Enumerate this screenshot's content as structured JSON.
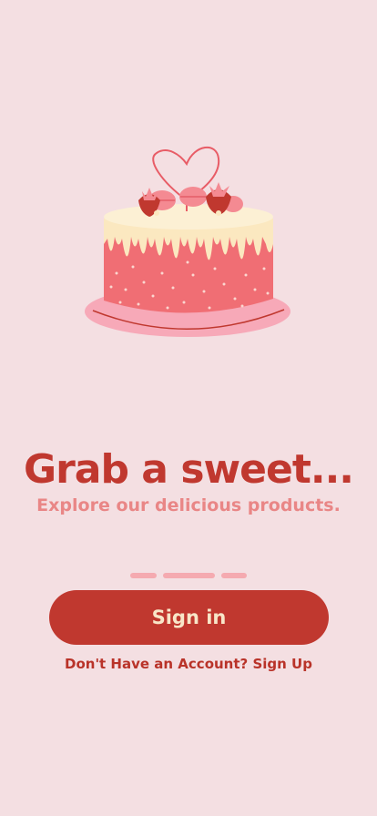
{
  "onboarding": {
    "headline": "Grab a sweet...",
    "subheadline": "Explore our delicious products.",
    "pager": {
      "total_pages": 3
    }
  },
  "actions": {
    "sign_in_label": "Sign in",
    "no_account_prompt": "Don't Have an Account?",
    "sign_up_link": "Sign Up"
  },
  "illustration": {
    "icon": "cake-illustration"
  },
  "colors": {
    "background": "#f4dfe2",
    "primary": "#c0382f",
    "accent": "#e98686",
    "pager": "#f5aab0",
    "button_text": "#f8e6c8"
  }
}
